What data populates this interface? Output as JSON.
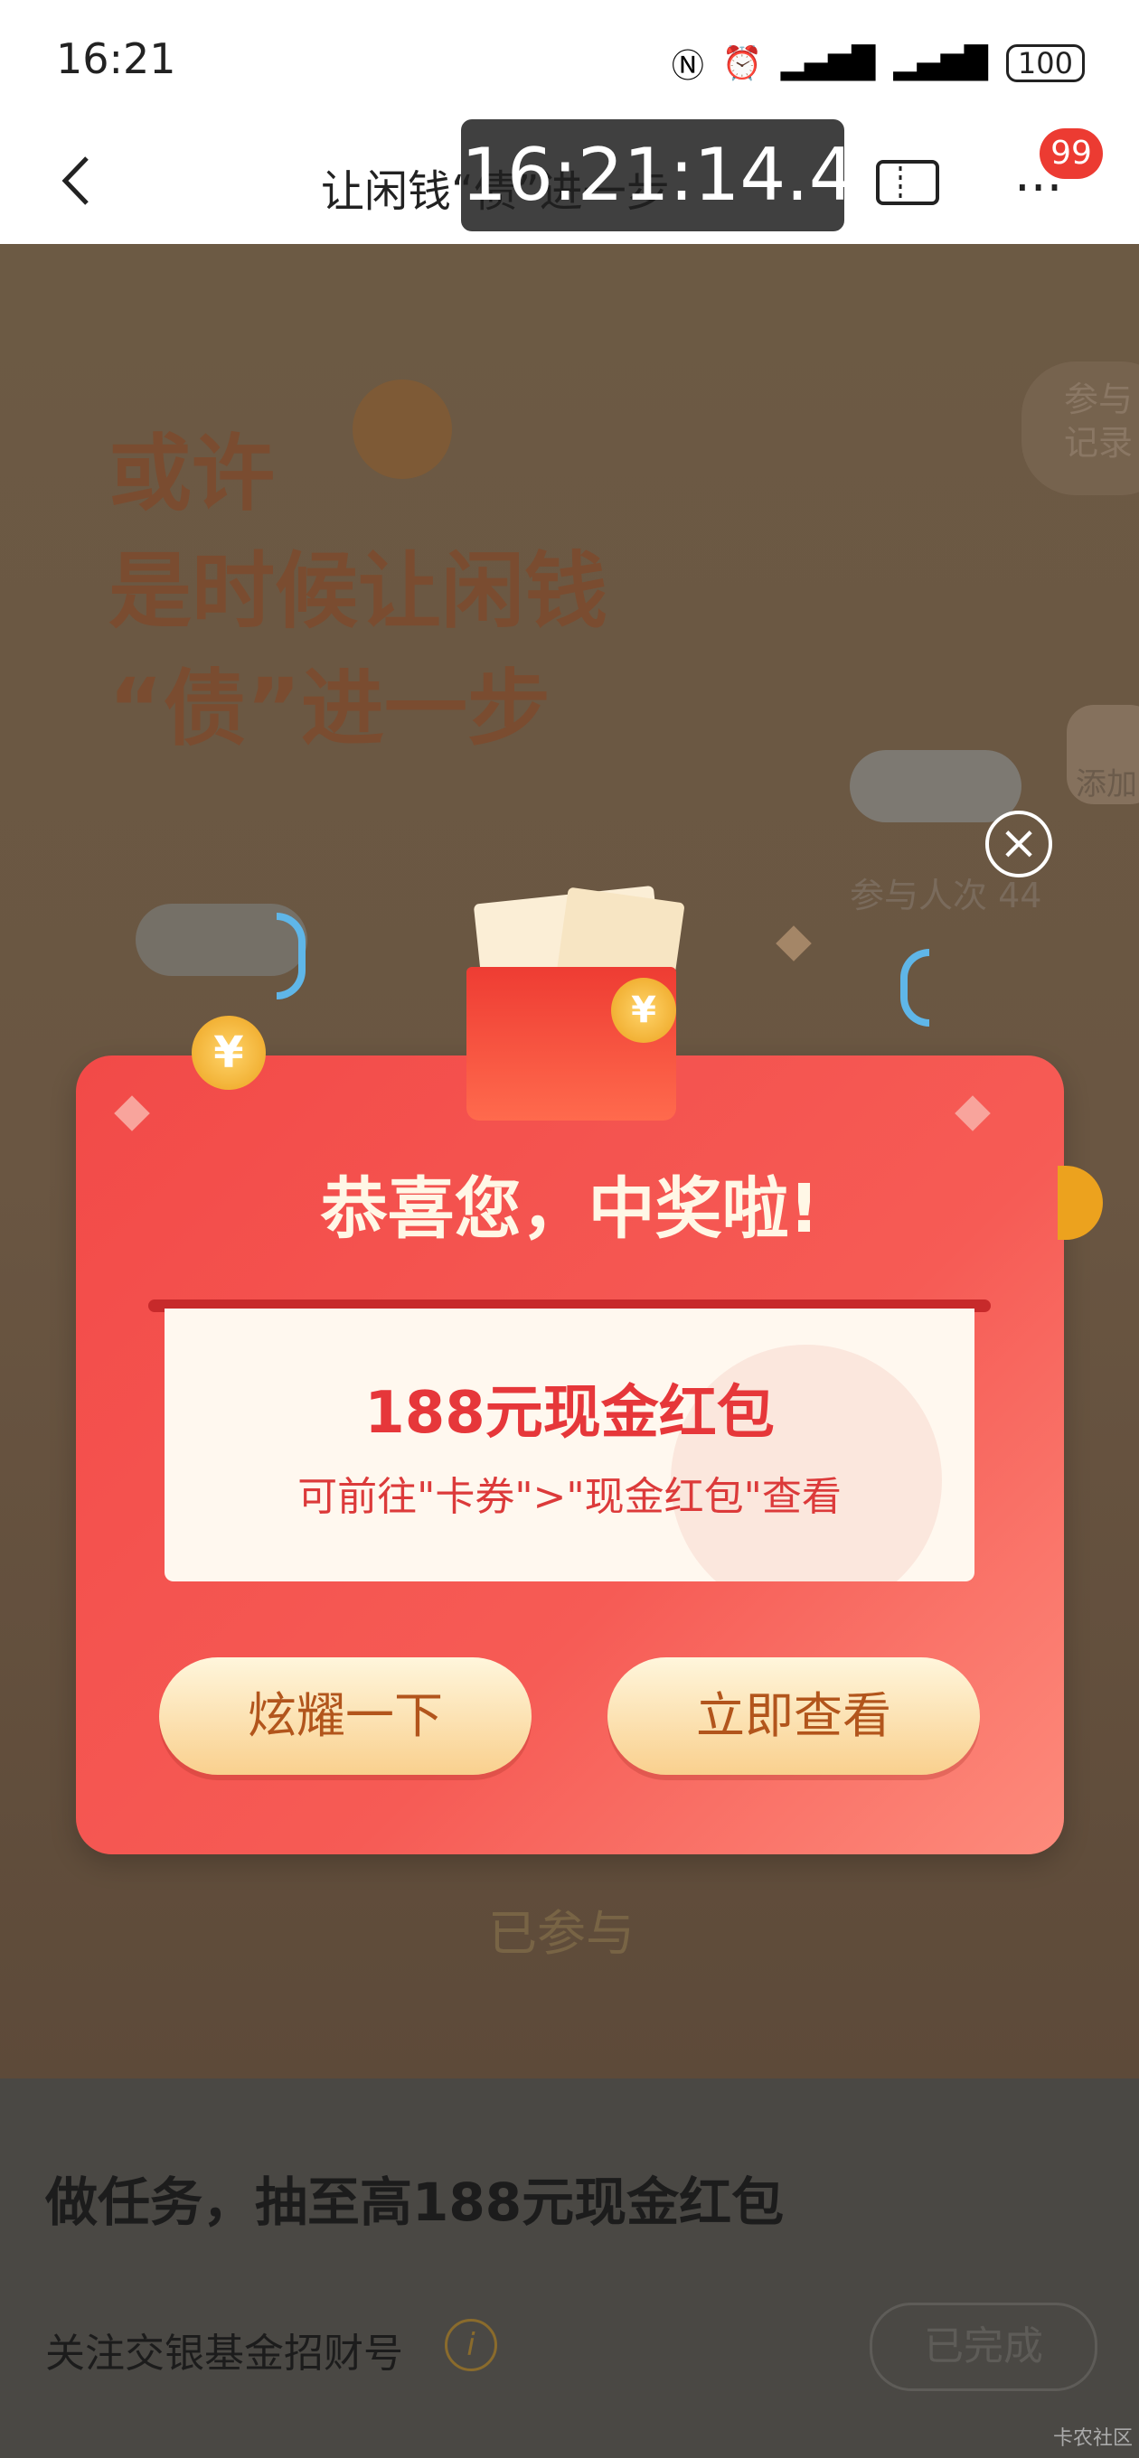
{
  "status_bar": {
    "time": "16:21",
    "battery": "100"
  },
  "nav": {
    "title": "让闲钱“债”进一步",
    "overlay_time": "16:21:14.4",
    "badge_count": "99"
  },
  "background": {
    "hero_lines": [
      "或许",
      "是时候让闲钱",
      "“债”进一步"
    ],
    "side_pill": "参与\n记录",
    "side_pill2": "添加",
    "participants": "参与人次 44",
    "joined_button": "已参与"
  },
  "popup": {
    "title": "恭喜您，中奖啦!",
    "prize": "188元现金红包",
    "hint": "可前往\"卡券\">\"现金红包\"查看",
    "share_button": "炫耀一下",
    "view_button": "立即查看"
  },
  "tasks": {
    "title": "做任务，抽至高188元现金红包",
    "items": [
      {
        "name": "关注交银基金招财号",
        "status": "已完成"
      }
    ]
  },
  "watermark": "卡农社区",
  "colors": {
    "accent_red": "#f24a48",
    "button_gold": "#f9d08e",
    "text_brown": "#b2551c"
  }
}
